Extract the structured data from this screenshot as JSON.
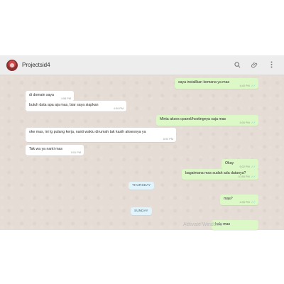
{
  "header": {
    "title": "Projectsid4",
    "search_icon": "search-icon",
    "attach_icon": "paperclip-icon",
    "menu_icon": "more-vert-icon"
  },
  "messages": [
    {
      "dir": "out",
      "text": "saya installkan kemana ya mas",
      "time": "4:40 PM",
      "ticks": "✓✓"
    },
    {
      "dir": "in",
      "text": "di domain saya",
      "time": "4:58 PM"
    },
    {
      "dir": "in",
      "text": "butuh data apa aja mas, biar saya siapkan",
      "time": "4:59 PM"
    },
    {
      "dir": "out",
      "text": "Minta akses cpanel/hostingnya saja mas",
      "time": "5:00 PM",
      "ticks": "✓✓"
    },
    {
      "dir": "in",
      "text": "oke mas, ini lg pulang kerja, nanti waktu dirumah tak kasih aksesnya ya",
      "time": "6:00 PM"
    },
    {
      "dir": "in",
      "text": "Tak wa ya nanti mas",
      "time": "9:51 PM"
    },
    {
      "dir": "out",
      "text": "Okay",
      "time": "5:02 PM",
      "ticks": "✓✓"
    },
    {
      "dir": "out",
      "text": "bagaimana mas sudah ada datanya?",
      "time": "10:55 PM",
      "ticks": "✓✓"
    },
    {
      "dir": "out",
      "text": "mas?",
      "time": "4:05 PM",
      "ticks": "✓✓"
    },
    {
      "dir": "out",
      "text": "halo mas",
      "time": "",
      "ticks": ""
    }
  ],
  "day_labels": [
    "THURSDAY",
    "SUNDAY"
  ],
  "watermark": "Activate Windows",
  "colors": {
    "header_bg": "#ededed",
    "chat_bg": "#e5ddd5",
    "outgoing_bubble": "#dcf8c6",
    "incoming_bubble": "#ffffff",
    "read_ticks": "#4fc3f7"
  }
}
